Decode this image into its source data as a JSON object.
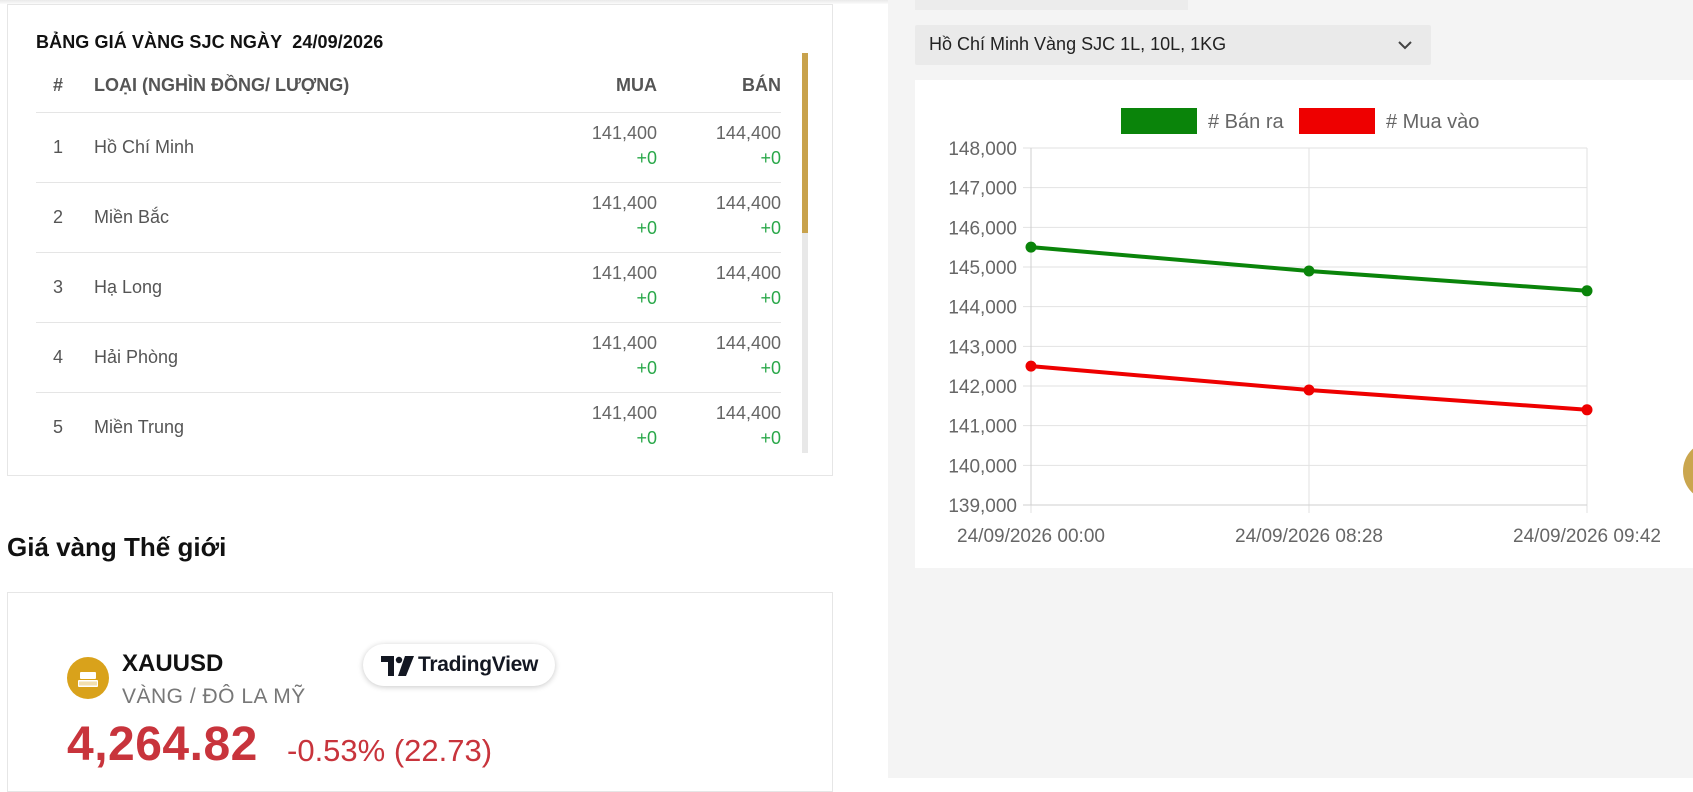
{
  "sjc_table": {
    "title": "BẢNG GIÁ VÀNG SJC NGÀY",
    "date": "24/09/2026",
    "headers": {
      "index": "#",
      "type": "LOẠI (NGHÌN ĐỒNG/ LƯỢNG)",
      "buy": "MUA",
      "sell": "BÁN"
    },
    "rows": [
      {
        "index": "1",
        "name": "Hồ Chí Minh",
        "buy": "141,400",
        "buy_change": "+0",
        "sell": "144,400",
        "sell_change": "+0"
      },
      {
        "index": "2",
        "name": "Miền Bắc",
        "buy": "141,400",
        "buy_change": "+0",
        "sell": "144,400",
        "sell_change": "+0"
      },
      {
        "index": "3",
        "name": "Hạ Long",
        "buy": "141,400",
        "buy_change": "+0",
        "sell": "144,400",
        "sell_change": "+0"
      },
      {
        "index": "4",
        "name": "Hải Phòng",
        "buy": "141,400",
        "buy_change": "+0",
        "sell": "144,400",
        "sell_change": "+0"
      },
      {
        "index": "5",
        "name": "Miền Trung",
        "buy": "141,400",
        "buy_change": "+0",
        "sell": "144,400",
        "sell_change": "+0"
      }
    ]
  },
  "world_gold": {
    "heading": "Giá vàng Thế giới",
    "symbol": "XAUUSD",
    "description": "VÀNG / ĐÔ LA MỸ",
    "badge": "TradingView",
    "price": "4,264.82",
    "change": "-0.53% (22.73)",
    "icon": "gold-bars-icon"
  },
  "selector": {
    "value": "Hồ Chí Minh Vàng SJC 1L, 10L, 1KG",
    "icon": "chevron-down-icon"
  },
  "chart_data": {
    "type": "line",
    "x": [
      "24/09/2026 00:00",
      "24/09/2026 08:28",
      "24/09/2026 09:42"
    ],
    "series": [
      {
        "name": "# Bán ra",
        "color": "#0a840a",
        "values": [
          145500,
          144900,
          144400
        ]
      },
      {
        "name": "# Mua vào",
        "color": "#ee0000",
        "values": [
          142500,
          141900,
          141400
        ]
      }
    ],
    "ylim": [
      139000,
      148000
    ],
    "yticks": [
      "148,000",
      "147,000",
      "146,000",
      "145,000",
      "144,000",
      "143,000",
      "142,000",
      "141,000",
      "140,000",
      "139,000"
    ],
    "grid": true,
    "legend": "top"
  }
}
